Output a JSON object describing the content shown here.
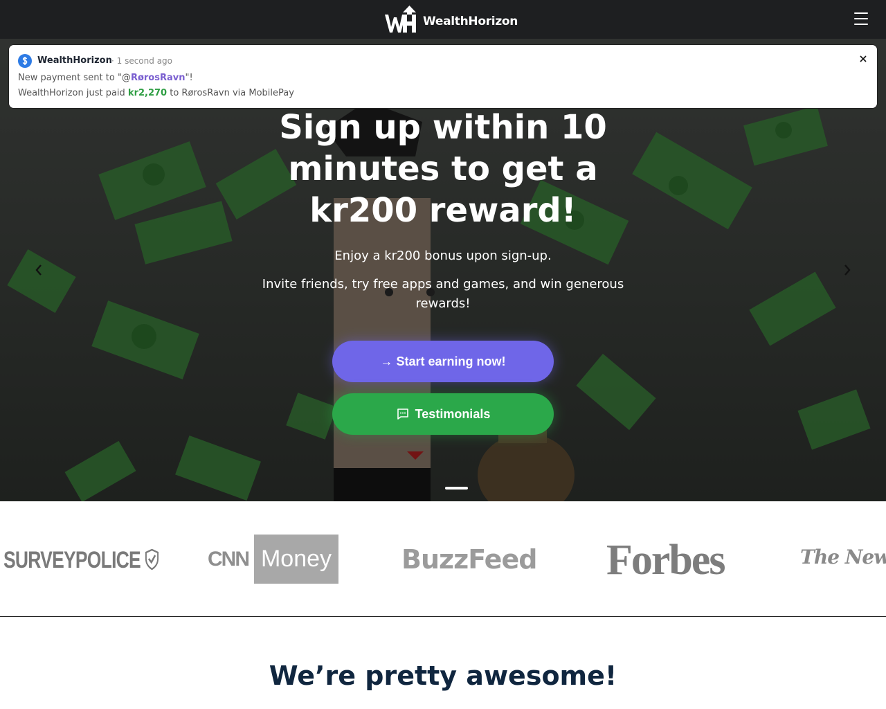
{
  "header": {
    "brand_name": "WealthHorizon",
    "menu_icon": "hamburger-icon"
  },
  "notification": {
    "icon": "dollar-icon",
    "brand": "WealthHorizon",
    "time": "· 1 second ago",
    "line1_prefix": "New payment sent to \"@",
    "line1_user": "RørosRavn",
    "line1_suffix": "\"!",
    "line2_prefix": "WealthHorizon just paid ",
    "line2_amount": "kr2,270",
    "line2_suffix": " to RørosRavn via MobilePay",
    "close_icon": "close-icon"
  },
  "hero": {
    "title": "Sign up within 10 minutes to get a kr200 reward!",
    "subtitle1": "Enjoy a kr200 bonus upon sign-up.",
    "subtitle2": "Invite friends, try free apps and games, and win generous rewards!",
    "primary_button": "→ Start earning now!",
    "secondary_button": "Testimonials",
    "secondary_icon": "chat-icon",
    "prev_icon": "chevron-left-icon",
    "next_icon": "chevron-right-icon"
  },
  "press": {
    "logos": [
      "SURVEYPOLICE",
      "CNN",
      "Money",
      "BuzzFeed",
      "Forbes",
      "The New York"
    ]
  },
  "section": {
    "title": "We’re pretty awesome!"
  },
  "colors": {
    "topbar": "#1e1f21",
    "primary": "#6f66e8",
    "secondary": "#2ba84a",
    "notification_icon": "#2d7be5",
    "heading": "#10263f"
  }
}
